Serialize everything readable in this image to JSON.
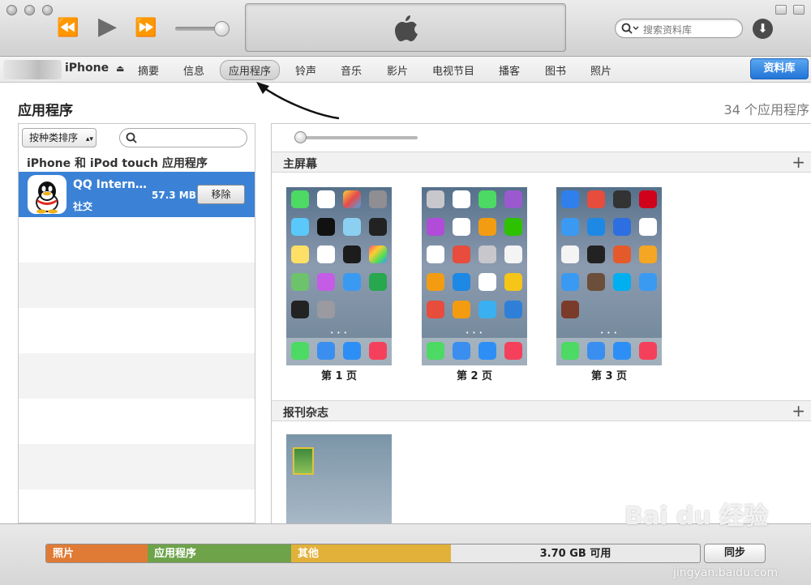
{
  "navbar": {
    "device_name": "iPhone",
    "tabs": [
      "摘要",
      "信息",
      "应用程序",
      "铃声",
      "音乐",
      "影片",
      "电视节目",
      "播客",
      "图书",
      "照片"
    ],
    "active_tab": "应用程序",
    "library_label": "资料库"
  },
  "toolbar": {
    "search_placeholder": "搜索资料库",
    "icons": [
      "rewind-icon",
      "play-icon",
      "fast-forward-icon",
      "volume-slider",
      "apple-logo-icon",
      "search-icon",
      "download-icon"
    ]
  },
  "content": {
    "title": "应用程序",
    "app_count": "34 个应用程序"
  },
  "left_panel": {
    "sort_label": "按种类排序",
    "section_label": "iPhone 和 iPod touch 应用程序",
    "apps": [
      {
        "name": "QQ Intern…",
        "category": "社交",
        "size": "57.3 MB",
        "action": "移除"
      }
    ]
  },
  "right_panel": {
    "home_screen_label": "主屏幕",
    "pages": [
      "第 1 页",
      "第 2 页",
      "第 3 页"
    ],
    "newsstand_label": "报刊杂志",
    "add_label": "+",
    "accent": "#3b82d6"
  },
  "capacity": {
    "segments": [
      {
        "label": "照片",
        "color": "#e07b35",
        "fraction": 0.155
      },
      {
        "label": "应用程序",
        "color": "#6ea34a",
        "fraction": 0.22
      },
      {
        "label": "其他",
        "color": "#e2b13a",
        "fraction": 0.245
      }
    ],
    "free_label": "3.70 GB 可用",
    "sync_label": "同步"
  },
  "watermark": {
    "brand": "Bai du 经验",
    "url": "jingyan.baidu.com"
  }
}
